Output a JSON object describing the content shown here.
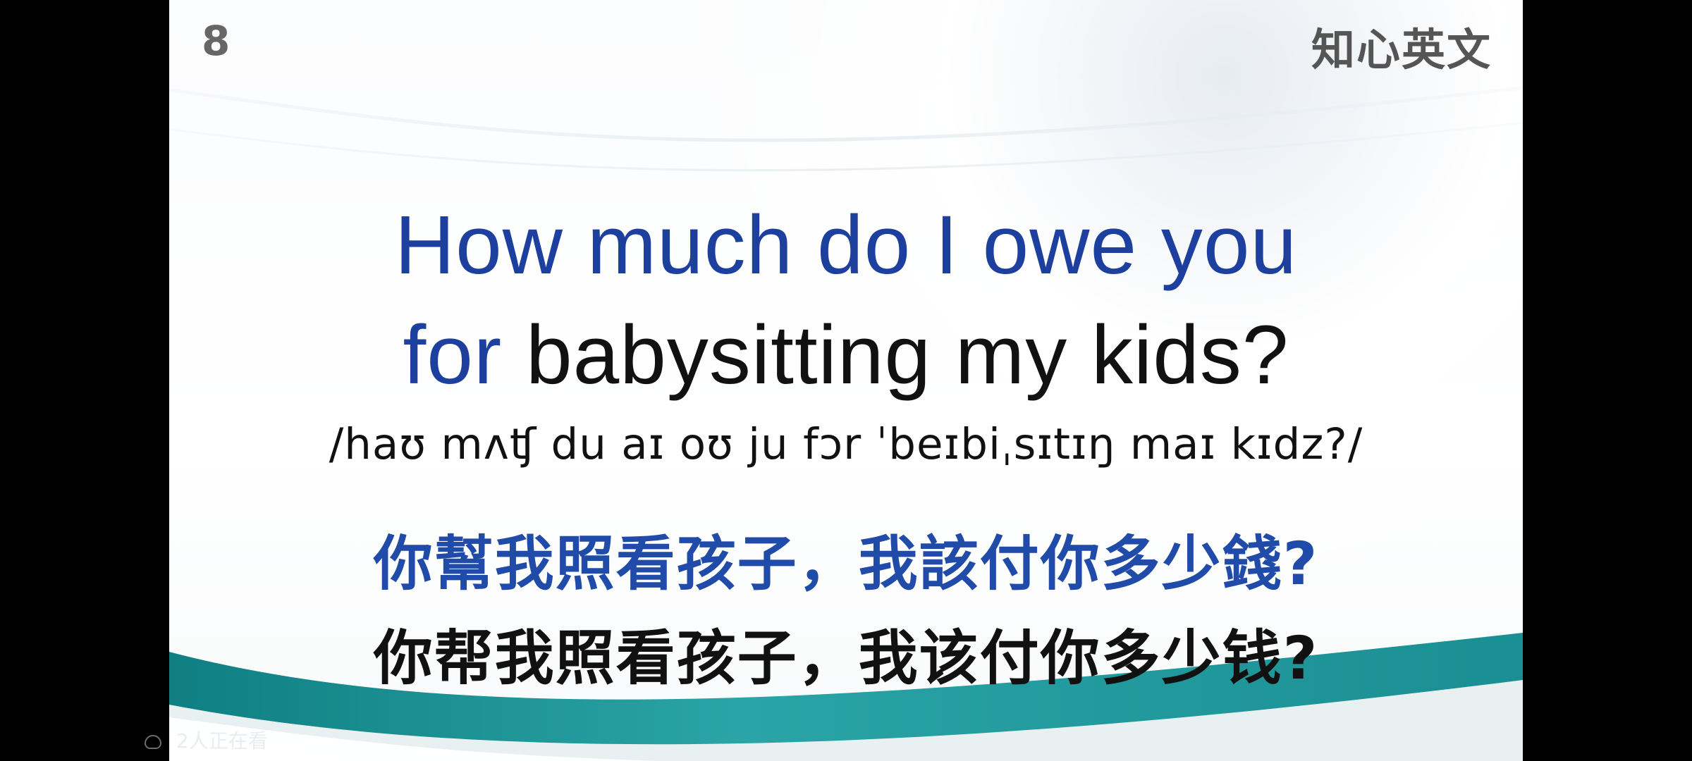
{
  "slide": {
    "page_number": "8",
    "brand": "知心英文",
    "english": {
      "blue_line_1": "How much do I owe you",
      "blue_line_2_prefix": "for",
      "black_line_2": "babysitting my kids?"
    },
    "phonetic": "/haʊ mʌʧ du aɪ oʊ ju fɔr ˈbeɪbiˌsɪtɪŋ maɪ kɪdz?/",
    "traditional_chinese": "你幫我照看孩子，我該付你多少錢?",
    "simplified_chinese": "你帮我照看孩子，我该付你多少钱?"
  },
  "overlay": {
    "viewers_text": "2人正在看"
  },
  "colors": {
    "blue": "#1d3f9d",
    "teal": "#1e9a99",
    "text_dark": "#111111",
    "text_gray": "#666666"
  }
}
